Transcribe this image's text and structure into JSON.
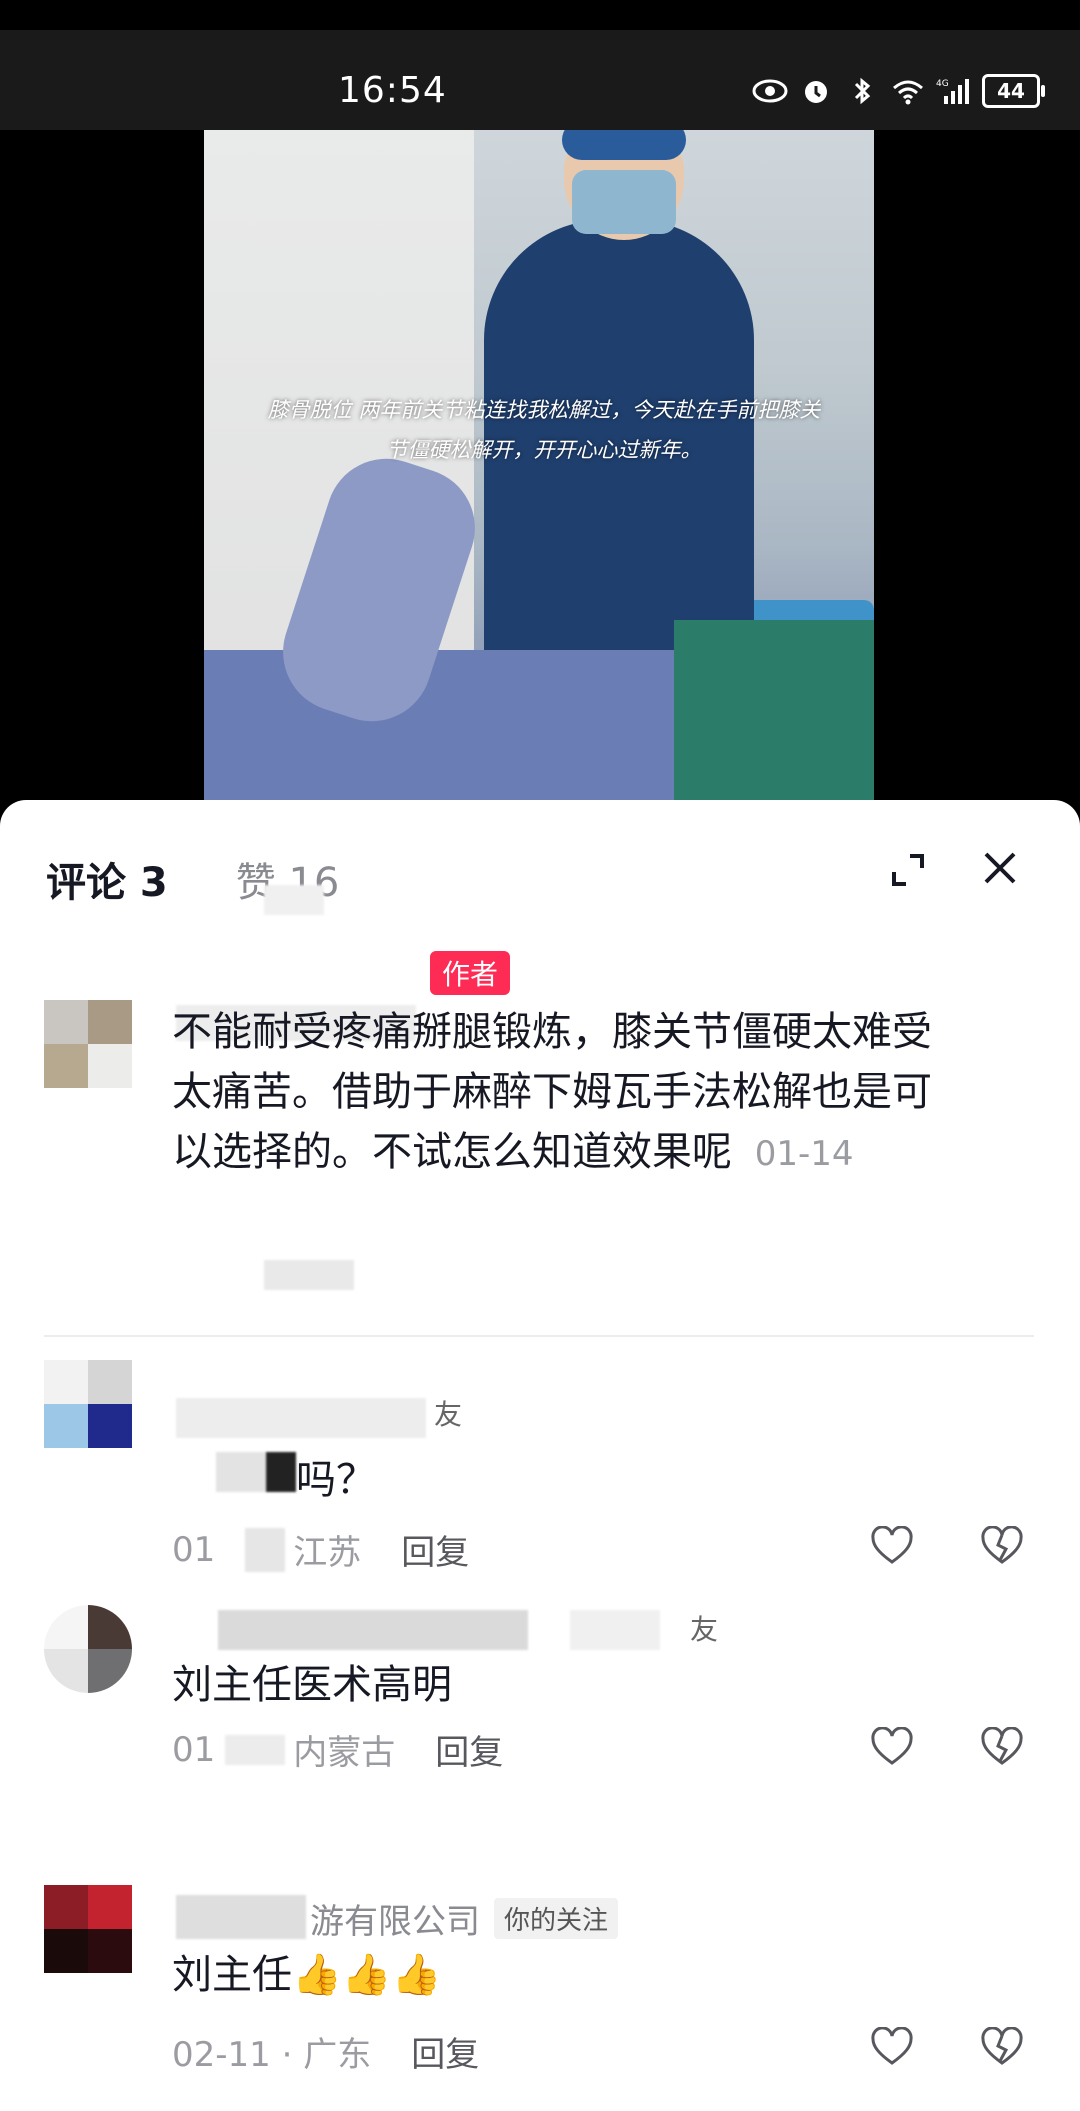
{
  "status_bar": {
    "time": "16:54",
    "battery": "44"
  },
  "video": {
    "caption": "膝骨脱位 两年前关节粘连找我松解过，今天赴在手前把膝关节僵硬松解开，开开心心过新年。"
  },
  "panel": {
    "tab_comments": "评论 3",
    "tab_likes": "赞 16"
  },
  "comments": [
    {
      "badge": "作者",
      "text": "不能耐受疼痛掰腿锻炼，膝关节僵硬太难受太痛苦。借助于麻醉下姆瓦手法松解也是可以选择的。不试怎么知道效果呢",
      "date": "01-14"
    },
    {
      "name_suffix": "友",
      "text": "吗？",
      "date": "01",
      "region": "江苏",
      "reply": "回复"
    },
    {
      "name_suffix": "友",
      "text": "刘主任医术高明",
      "date": "01",
      "region": "内蒙古",
      "reply": "回复"
    },
    {
      "name": "游有限公司",
      "badge": "你的关注",
      "text": "刘主任",
      "emoji": "👍👍👍",
      "date": "02-11 · 广东",
      "reply": "回复"
    }
  ],
  "colors": {
    "accent": "#fe2c55",
    "sheet_bg": "#ffffff",
    "muted": "#8a8b91"
  }
}
